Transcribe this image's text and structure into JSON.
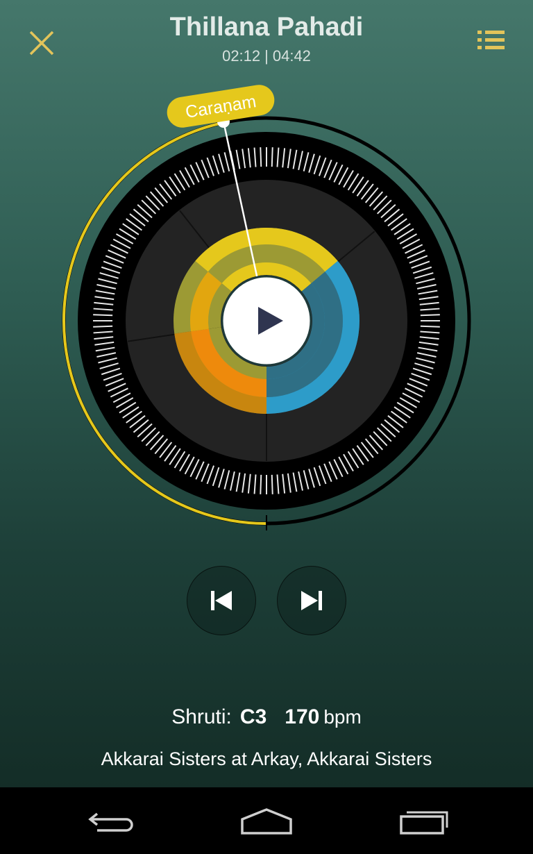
{
  "header": {
    "title": "Thillana Pahadi",
    "elapsed": "02:12",
    "separator": "|",
    "duration": "04:42"
  },
  "dial": {
    "section_label": "Caraṇam",
    "progress_fraction": 0.468,
    "colors": {
      "highlight": "#e5c81c",
      "yellow": "#e5c81c",
      "orange": "#ee8a0c",
      "blue": "#2d9cc9",
      "olive": "#9c9a34"
    }
  },
  "controls": {
    "play_icon": "play-icon",
    "prev_icon": "skip-previous-icon",
    "next_icon": "skip-next-icon"
  },
  "info": {
    "shruti_label": "Shruti:",
    "shruti_value": "C3",
    "tempo_value": "170",
    "tempo_unit": "bpm",
    "artist": "Akkarai Sisters at Arkay, Akkarai Sisters"
  },
  "navbar": {
    "back_icon": "back-icon",
    "home_icon": "home-icon",
    "recent_icon": "recent-apps-icon"
  }
}
